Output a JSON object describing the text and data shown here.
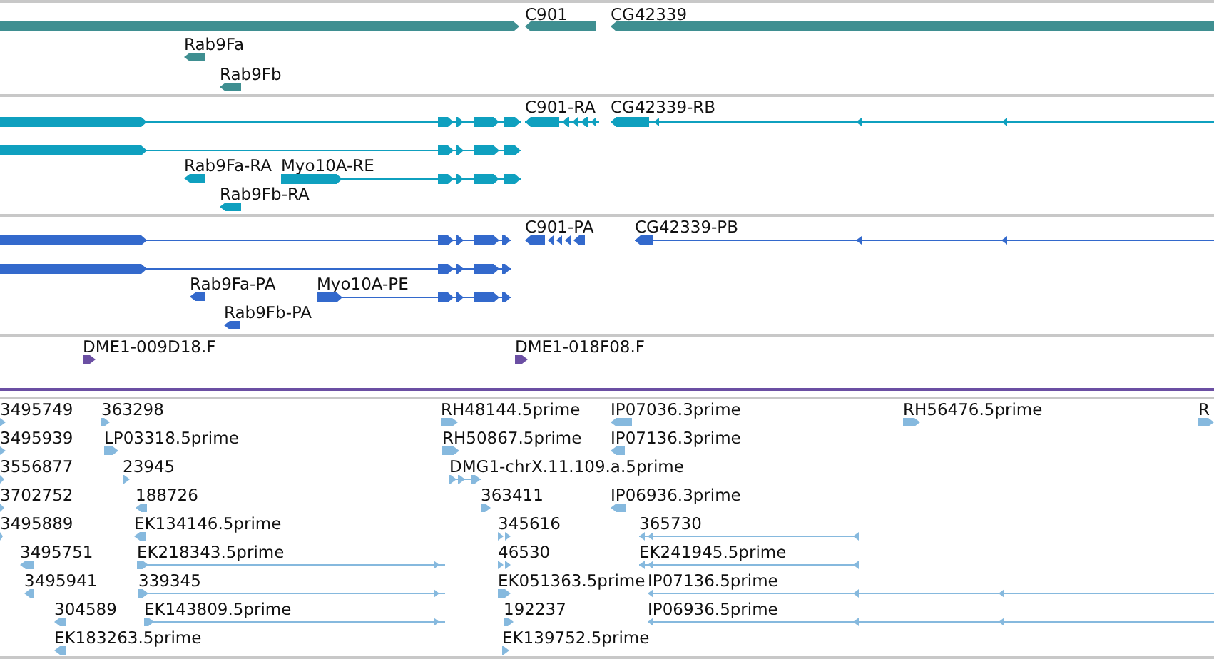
{
  "tracks": [
    {
      "kind": "gene",
      "color": "#3f8f91",
      "features": [
        {
          "reverse": false
        },
        {
          "label": "C901",
          "reverse": true
        },
        {
          "label": "CG42339",
          "reverse": true
        },
        {
          "label": "Rab9Fa",
          "reverse": true
        },
        {
          "label": "Rab9Fb",
          "reverse": true
        }
      ]
    },
    {
      "kind": "transcript",
      "color": "#0fa0bf",
      "features": [
        {
          "reverse": false
        },
        {
          "label": "C901-RA",
          "reverse": true
        },
        {
          "label": "CG42339-RB",
          "reverse": true
        },
        {
          "reverse": false
        },
        {
          "label": "Rab9Fa-RA",
          "reverse": true
        },
        {
          "label": "Myo10A-RE",
          "reverse": false
        },
        {
          "label": "Rab9Fb-RA",
          "reverse": true
        }
      ]
    },
    {
      "kind": "protein",
      "color": "#3369cc",
      "features": [
        {
          "reverse": false
        },
        {
          "label": "C901-PA",
          "reverse": true
        },
        {
          "label": "CG42339-PB",
          "reverse": true
        },
        {
          "reverse": false
        },
        {
          "label": "Rab9Fa-PA",
          "reverse": true
        },
        {
          "label": "Myo10A-PE",
          "reverse": false
        },
        {
          "label": "Rab9Fb-PA",
          "reverse": true
        }
      ]
    },
    {
      "kind": "clone",
      "color": "#6b4fa3",
      "features": [
        {
          "label": "DME1-009D18.F",
          "reverse": false
        },
        {
          "label": "DME1-018F08.F",
          "reverse": false
        }
      ]
    },
    {
      "kind": "est",
      "color": "#86b9de",
      "features": [
        {
          "label": "3495749",
          "reverse": false
        },
        {
          "label": "363298",
          "reverse": false
        },
        {
          "label": "RH48144.5prime",
          "reverse": false
        },
        {
          "label": "IP07036.3prime",
          "reverse": true
        },
        {
          "label": "RH56476.5prime",
          "reverse": false
        },
        {
          "label": "R",
          "reverse": false
        },
        {
          "label": "3495939",
          "reverse": false
        },
        {
          "label": "LP03318.5prime",
          "reverse": false
        },
        {
          "label": "RH50867.5prime",
          "reverse": false
        },
        {
          "label": "IP07136.3prime",
          "reverse": true
        },
        {
          "label": "3556877",
          "reverse": false
        },
        {
          "label": "23945",
          "reverse": false
        },
        {
          "label": "DMG1-chrX.11.109.a.5prime",
          "reverse": false
        },
        {
          "label": "3702752",
          "reverse": false
        },
        {
          "label": "188726",
          "reverse": true
        },
        {
          "label": "363411",
          "reverse": false
        },
        {
          "label": "IP06936.3prime",
          "reverse": true
        },
        {
          "label": "3495889",
          "reverse": false
        },
        {
          "label": "EK134146.5prime",
          "reverse": true
        },
        {
          "label": "345616",
          "reverse": false
        },
        {
          "label": "365730",
          "reverse": true
        },
        {
          "label": "3495751",
          "reverse": true
        },
        {
          "label": "EK218343.5prime",
          "reverse": false
        },
        {
          "label": "46530",
          "reverse": false
        },
        {
          "label": "EK241945.5prime",
          "reverse": true
        },
        {
          "label": "3495941",
          "reverse": true
        },
        {
          "label": "339345",
          "reverse": false
        },
        {
          "label": "EK051363.5prime",
          "reverse": false
        },
        {
          "label": "IP07136.5prime",
          "reverse": true
        },
        {
          "label": "304589",
          "reverse": true
        },
        {
          "label": "EK143809.5prime",
          "reverse": false
        },
        {
          "label": "192237",
          "reverse": false
        },
        {
          "label": "IP06936.5prime",
          "reverse": true
        },
        {
          "label": "EK183263.5prime",
          "reverse": true
        },
        {
          "label": "EK139752.5prime",
          "reverse": false
        }
      ]
    }
  ]
}
